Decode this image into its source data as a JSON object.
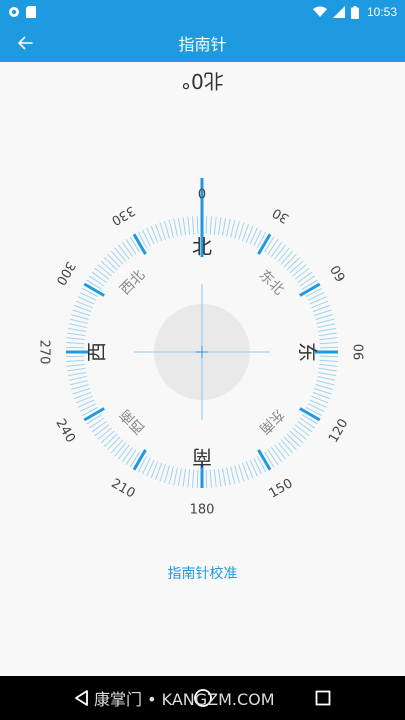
{
  "status_bar": {
    "time": "10:53",
    "icons": [
      "circle-notification-icon",
      "sd-card-icon",
      "wifi-icon",
      "signal-icon",
      "battery-icon"
    ]
  },
  "app_bar": {
    "title": "指南针",
    "back_icon": "arrow-left-icon"
  },
  "heading": {
    "text": "北0°"
  },
  "compass": {
    "accent_color": "#1e9be0",
    "tick_color": "#9fd3ef",
    "degree_labels": [
      "0",
      "30",
      "60",
      "90",
      "120",
      "150",
      "180",
      "210",
      "240",
      "270",
      "300",
      "330"
    ],
    "cardinal": {
      "north": "北",
      "east": "东",
      "south": "南",
      "west": "西"
    },
    "intercardinal": {
      "northeast": "东北",
      "southeast": "东南",
      "southwest": "西南",
      "northwest": "西北"
    }
  },
  "calibration": {
    "label": "指南针校准"
  },
  "nav_bar": {
    "watermark": "康掌门 • KANGZM.COM",
    "back_icon": "triangle-back-icon",
    "home_icon": "circle-home-icon",
    "recent_icon": "square-recent-icon"
  }
}
